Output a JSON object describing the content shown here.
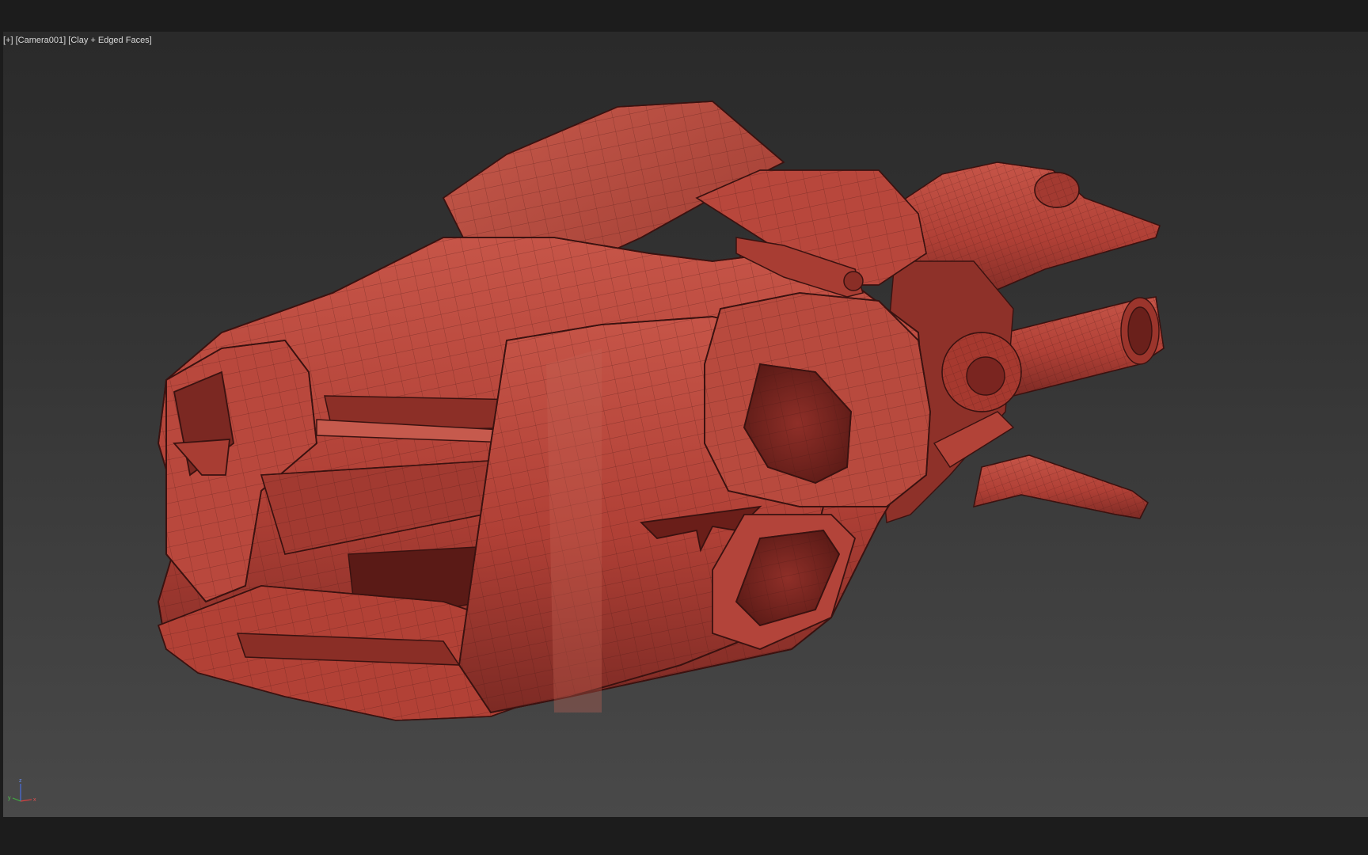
{
  "viewport": {
    "label_parts": [
      "[+]",
      "[Camera001]",
      "[Clay + Edged Faces]"
    ],
    "background_top": "#2a2a2a",
    "background_bottom": "#494949"
  },
  "model": {
    "material_color": "#b8453a",
    "shadow_color": "#7a2520",
    "highlight_color": "#cf6a5c",
    "edge_color": "#3a1210"
  },
  "axis_gizmo": {
    "x_label": "x",
    "y_label": "y",
    "z_label": "z",
    "x_color": "#d04040",
    "y_color": "#40b040",
    "z_color": "#4a6ee0"
  }
}
